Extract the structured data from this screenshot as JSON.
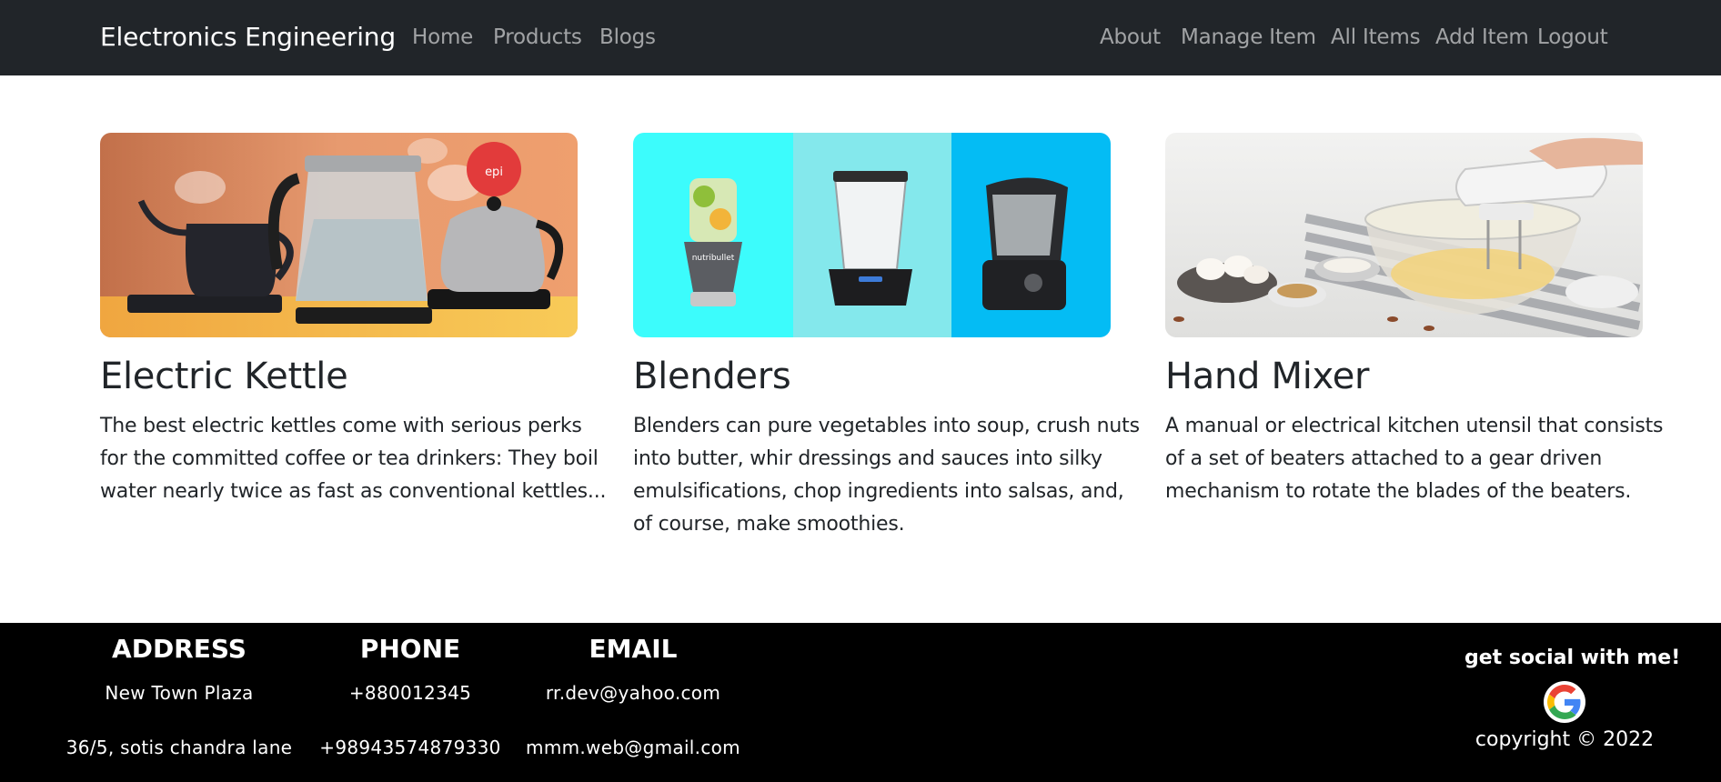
{
  "navbar": {
    "brand": "Electronics Engineering",
    "left_links": [
      "Home",
      "Products",
      "Blogs"
    ],
    "right_links": [
      "About",
      "Manage Item",
      "All Items",
      "Add Item",
      "Logout"
    ]
  },
  "products": [
    {
      "title": "Electric Kettle",
      "description": "The best electric kettles come with serious perks for the committed coffee or tea drinkers: They boil water nearly twice as fast as conventional kettles...",
      "image_icon": "electric-kettle-image",
      "image_badge": "epi"
    },
    {
      "title": "Blenders",
      "description": "Blenders can pure vegetables into soup, crush nuts into butter, whir dressings and sauces into silky emulsifications, chop ingredients into salsas, and, of course, make smoothies.",
      "image_icon": "blenders-image",
      "image_brand": "nutribullet"
    },
    {
      "title": "Hand Mixer",
      "description": "A manual or electrical kitchen utensil that consists of a set of beaters attached to a gear driven mechanism to rotate the blades of the beaters.",
      "image_icon": "hand-mixer-image"
    }
  ],
  "footer": {
    "columns": [
      {
        "heading": "ADDRESS",
        "lines": [
          "New Town Plaza",
          "36/5, sotis chandra lane"
        ]
      },
      {
        "heading": "PHONE",
        "lines": [
          "+880012345",
          "+98943574879330"
        ]
      },
      {
        "heading": "EMAIL",
        "lines": [
          "rr.dev@yahoo.com",
          "mmm.web@gmail.com"
        ]
      }
    ],
    "social_heading": "get social with me!",
    "social_icon": "google-icon",
    "copyright": "copyright © 2022"
  },
  "colors": {
    "navbar_bg": "#212529",
    "footer_bg": "#000000",
    "nav_link": "rgba(255,255,255,0.55)",
    "blender_panel_1": "#3cfcfc",
    "blender_panel_2": "#84e8ec",
    "blender_panel_3": "#04bcf4"
  }
}
